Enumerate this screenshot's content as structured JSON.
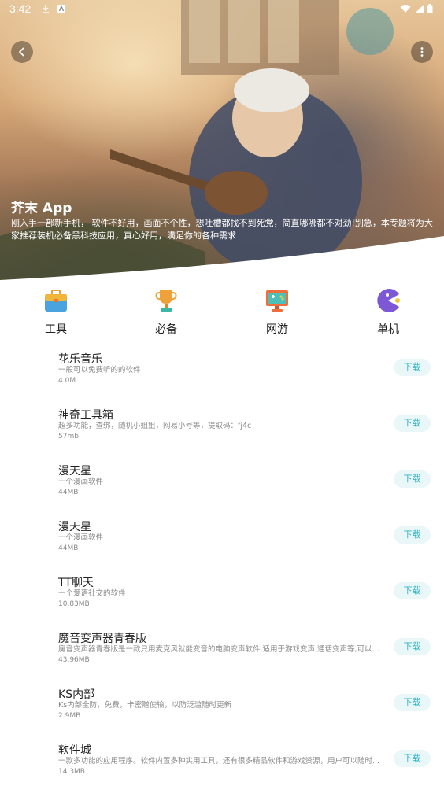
{
  "status_bar": {
    "time": "3:42"
  },
  "hero": {
    "title": "芥末 App",
    "description": "刚入手一部新手机， 软件不好用，画面不个性，想吐槽都找不到死党，简直哪哪都不对劲!别急，本专题将为大家推荐装机必备黑科技应用，真心好用，满足你的各种需求"
  },
  "categories": [
    {
      "label": "工具",
      "icon": "toolbox-icon",
      "color": "#4aa3df"
    },
    {
      "label": "必备",
      "icon": "trophy-icon",
      "color": "#f0a23a"
    },
    {
      "label": "网游",
      "icon": "game-monitor-icon",
      "color": "#f06d3c"
    },
    {
      "label": "单机",
      "icon": "pacman-icon",
      "color": "#7d58d6"
    }
  ],
  "apps": [
    {
      "title": "花乐音乐",
      "desc": "一般可以免费听的的软件",
      "size": "4.0M",
      "button": "下载"
    },
    {
      "title": "神奇工具箱",
      "desc": "超多功能，查绑，随机小姐姐，网易小号等，提取码：fj4c",
      "size": "57mb",
      "button": "下载"
    },
    {
      "title": "漫天星",
      "desc": "一个漫画软件",
      "size": "44MB",
      "button": "下载"
    },
    {
      "title": "漫天星",
      "desc": "一个漫画软件",
      "size": "44MB",
      "button": "下载"
    },
    {
      "title": "TT聊天",
      "desc": "一个爱语社交的软件",
      "size": "10.83MB",
      "button": "下载"
    },
    {
      "title": "魔音变声器青春版",
      "desc": "魔音变声器青春版是一款只用麦克风就能变音的电脑变声软件,适用于游戏变声,通话变声等,可以实...",
      "size": "43.96MB",
      "button": "下载"
    },
    {
      "title": "KS内部",
      "desc": "Ks内部全防，免费，卡密赠使输，以防泛滥随时更新",
      "size": "2.9MB",
      "button": "下载"
    },
    {
      "title": "软件城",
      "desc": "一款多功能的应用程序。软件内置多种实用工具，还有很多精品软件和游戏资源，用户可以随时...",
      "size": "14.3MB",
      "button": "下载"
    }
  ]
}
